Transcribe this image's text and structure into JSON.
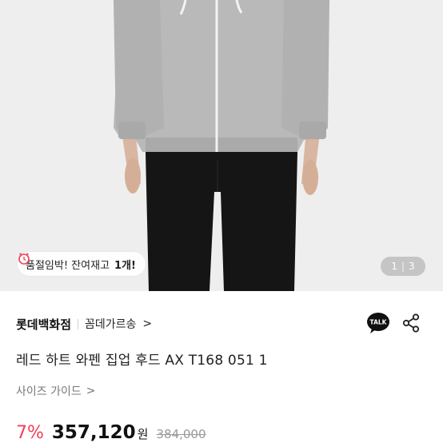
{
  "stock_alert": {
    "text_prefix": "품절임박! 잔여재고",
    "text_count": "1개!"
  },
  "pager": {
    "current": "1",
    "total": "3"
  },
  "seller": {
    "name": "롯데백화점",
    "shipping": "꼼데가르송"
  },
  "product": {
    "title": "레드 하트 와펜 집업 후드 AX T168 051 1"
  },
  "size_guide": {
    "label": "사이즈 가이드"
  },
  "price": {
    "discount": "7%",
    "sale": "357,120",
    "currency": "원",
    "original": "384,000"
  },
  "colors": {
    "discount": "#f0405a",
    "hero_bg": "#eeeeee",
    "hoodie": "#b9b9b9",
    "pants": "#151515"
  },
  "icons": {
    "kakao_talk": "talk-icon",
    "share": "share-icon",
    "clock": "alarm-clock-icon"
  }
}
